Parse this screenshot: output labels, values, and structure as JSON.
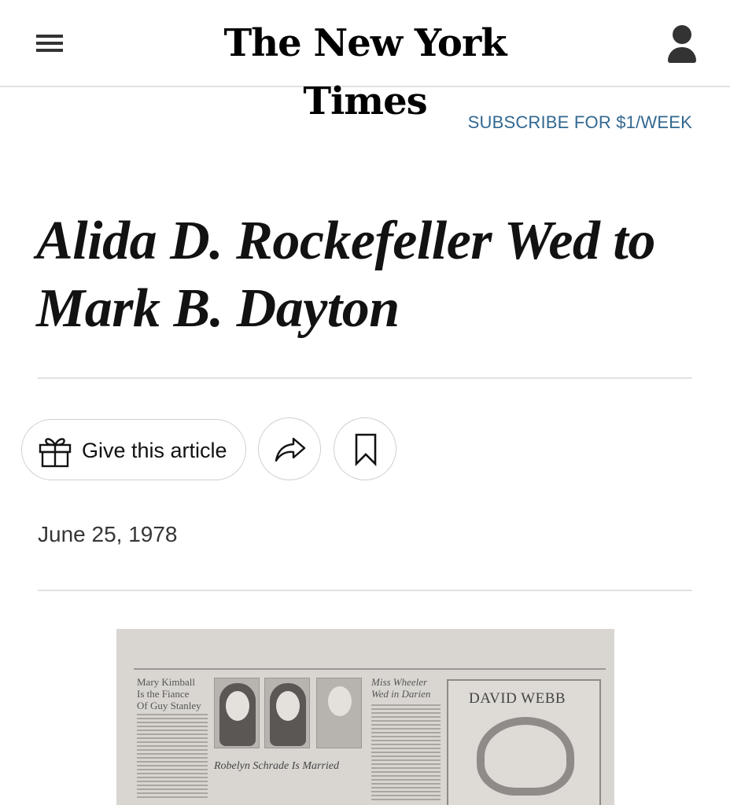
{
  "header": {
    "logo": "The New York Times",
    "menu_icon": "hamburger-menu-icon",
    "account_icon": "user-account-icon"
  },
  "subscribe": "SUBSCRIBE FOR $1/WEEK",
  "article": {
    "headline": "Alida D. Rockefeller Wed to Mark B. Dayton",
    "date": "June 25, 1978"
  },
  "actions": {
    "gift_label": "Give this article",
    "gift_icon": "gift-icon",
    "share_icon": "share-arrow-icon",
    "save_icon": "bookmark-icon"
  },
  "scan": {
    "col1_head": "Mary Kimball\nIs the Fiance\nOf Guy Stanley",
    "col2_head": "Miss Wheeler\nWed in Darien",
    "ad_title": "DAVID WEBB",
    "caption": "Robelyn Schrade Is Married"
  },
  "colors": {
    "link": "#326891",
    "rule": "#e2e2e2",
    "text": "#121212"
  }
}
